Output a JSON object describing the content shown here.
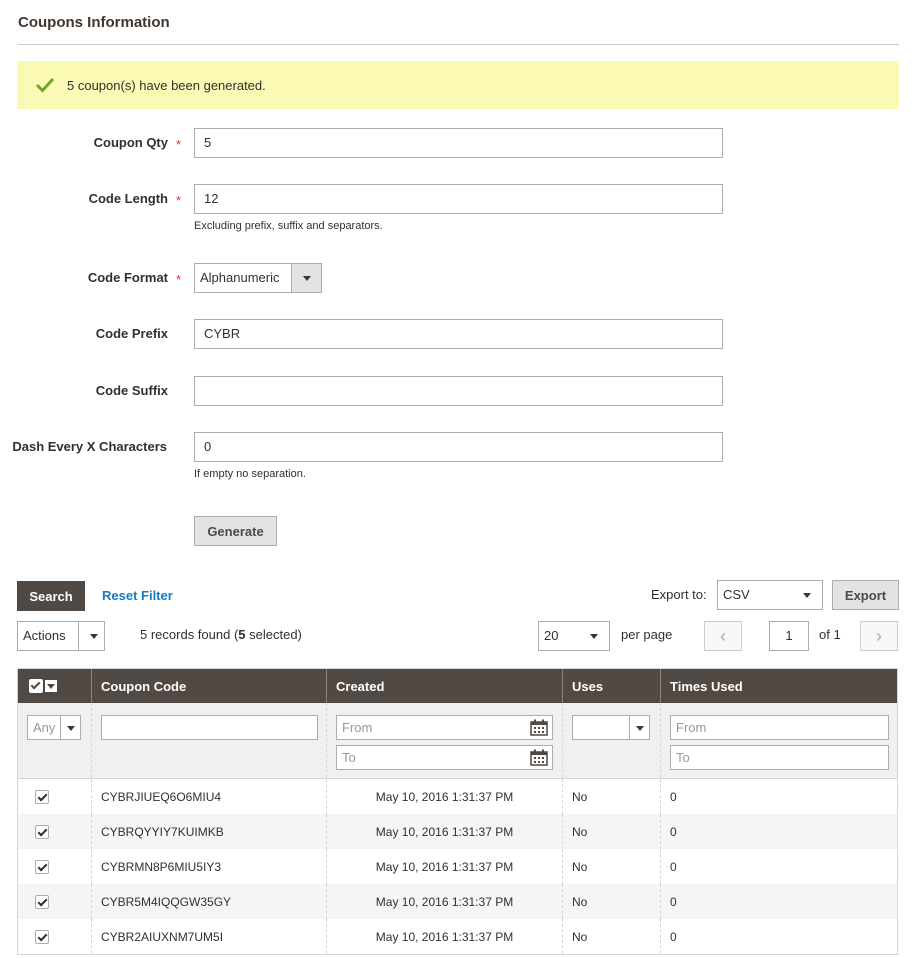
{
  "section": {
    "title": "Coupons Information"
  },
  "message": {
    "text": "5 coupon(s) have been generated."
  },
  "form": {
    "qty_label": "Coupon Qty",
    "qty_value": "5",
    "length_label": "Code Length",
    "length_value": "12",
    "length_note": "Excluding prefix, suffix and separators.",
    "format_label": "Code Format",
    "format_value": "Alphanumeric",
    "prefix_label": "Code Prefix",
    "prefix_value": "CYBR",
    "suffix_label": "Code Suffix",
    "suffix_value": "",
    "dash_label": "Dash Every X Characters",
    "dash_value": "0",
    "dash_note": "If empty no separation.",
    "required_mark": "*",
    "generate_label": "Generate"
  },
  "toolbar": {
    "search_label": "Search",
    "reset_label": "Reset Filter",
    "export_to_label": "Export to:",
    "export_format": "CSV",
    "export_label": "Export",
    "actions_label": "Actions",
    "records_prefix": "5 records found (",
    "selected_count": "5",
    "records_suffix": " selected)",
    "per_page_value": "20",
    "per_page_label": "per page",
    "page_current": "1",
    "page_total": "of 1"
  },
  "grid": {
    "headers": [
      "Coupon Code",
      "Created",
      "Uses",
      "Times Used"
    ],
    "filters": {
      "any": "Any",
      "from": "From",
      "to": "To"
    },
    "rows": [
      {
        "code": "CYBRJIUEQ6O6MIU4",
        "created": "May 10, 2016 1:31:37 PM",
        "uses": "No",
        "times": "0"
      },
      {
        "code": "CYBRQYYIY7KUIMKB",
        "created": "May 10, 2016 1:31:37 PM",
        "uses": "No",
        "times": "0"
      },
      {
        "code": "CYBRMN8P6MIU5IY3",
        "created": "May 10, 2016 1:31:37 PM",
        "uses": "No",
        "times": "0"
      },
      {
        "code": "CYBR5M4IQQGW35GY",
        "created": "May 10, 2016 1:31:37 PM",
        "uses": "No",
        "times": "0"
      },
      {
        "code": "CYBR2AIUXNM7UM5I",
        "created": "May 10, 2016 1:31:37 PM",
        "uses": "No",
        "times": "0"
      }
    ]
  },
  "colors": {
    "accent": "#1979c3",
    "header_bg": "#514943",
    "success_bg": "#fafab4",
    "success_icon": "#79a22e",
    "required": "#e02b27"
  }
}
